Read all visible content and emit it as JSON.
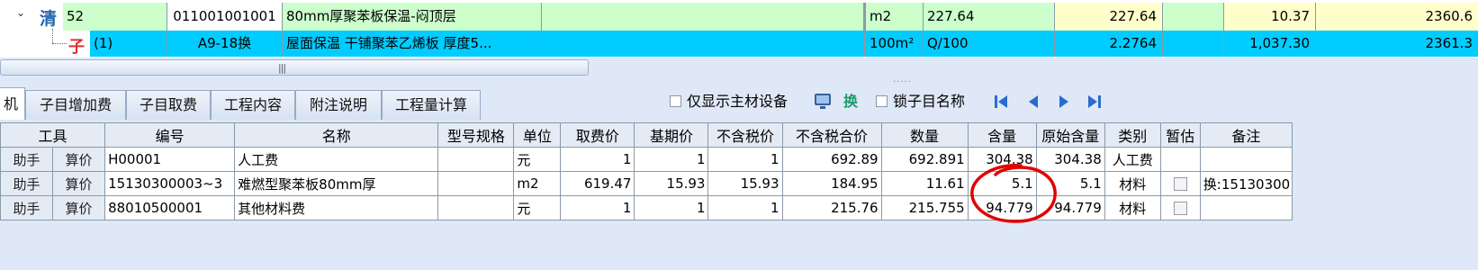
{
  "top_grid": {
    "row1": {
      "tree_label": "清",
      "seq": "52",
      "code": "011001001001",
      "name": "80mm厚聚苯板保温-闷顶层",
      "unit": "m2",
      "quantity": "227.64",
      "col_a": "227.64",
      "col_b": "10.37",
      "col_c": "2360.6"
    },
    "row2": {
      "tree_label": "子",
      "seq": "(1)",
      "code": "A9-18换",
      "name": "屋面保温 干铺聚苯乙烯板 厚度5...",
      "unit": "100m²",
      "quantity": "Q/100",
      "col_a": "2.2764",
      "col_b": "1,037.30",
      "col_c": "2361.3"
    }
  },
  "tabs": [
    {
      "label": "机"
    },
    {
      "label": "子目增加费"
    },
    {
      "label": "子目取费"
    },
    {
      "label": "工程内容"
    },
    {
      "label": "附注说明"
    },
    {
      "label": "工程量计算"
    }
  ],
  "toolbar": {
    "only_main_material": "仅显示主材设备",
    "swap_label": "换",
    "lock_name": "锁子目名称"
  },
  "table": {
    "headers": [
      "工具",
      "编号",
      "名称",
      "型号规格",
      "单位",
      "取费价",
      "基期价",
      "不含税价",
      "不含税合价",
      "数量",
      "含量",
      "原始含量",
      "类别",
      "暂估",
      "备注"
    ],
    "rows": [
      {
        "helper": "助手",
        "calc": "算价",
        "code": "H00001",
        "name": "人工费",
        "spec": "",
        "unit": "元",
        "fee_price": "1",
        "base_price": "1",
        "ex_tax_price": "1",
        "ex_tax_total": "692.89",
        "qty": "692.891",
        "content": "304.38",
        "orig_content": "304.38",
        "category": "人工费",
        "estimate": false,
        "remark": ""
      },
      {
        "helper": "助手",
        "calc": "算价",
        "code": "15130300003~3",
        "name": "难燃型聚苯板80mm厚",
        "spec": "",
        "unit": "m2",
        "fee_price": "619.47",
        "base_price": "15.93",
        "ex_tax_price": "15.93",
        "ex_tax_total": "184.95",
        "qty": "11.61",
        "content": "5.1",
        "orig_content": "5.1",
        "category": "材料",
        "estimate": false,
        "remark": "换:15130300"
      },
      {
        "helper": "助手",
        "calc": "算价",
        "code": "88010500001",
        "name": "其他材料费",
        "spec": "",
        "unit": "元",
        "fee_price": "1",
        "base_price": "1",
        "ex_tax_price": "1",
        "ex_tax_total": "215.76",
        "qty": "215.755",
        "content": "94.779",
        "orig_content": "94.779",
        "category": "材料",
        "estimate": false,
        "remark": ""
      }
    ]
  },
  "colors": {
    "row1_bg": "#ccffcc",
    "row2_bg": "#00ccff",
    "yellow_cell": "#ffffcc",
    "annotation": "#e00000"
  }
}
